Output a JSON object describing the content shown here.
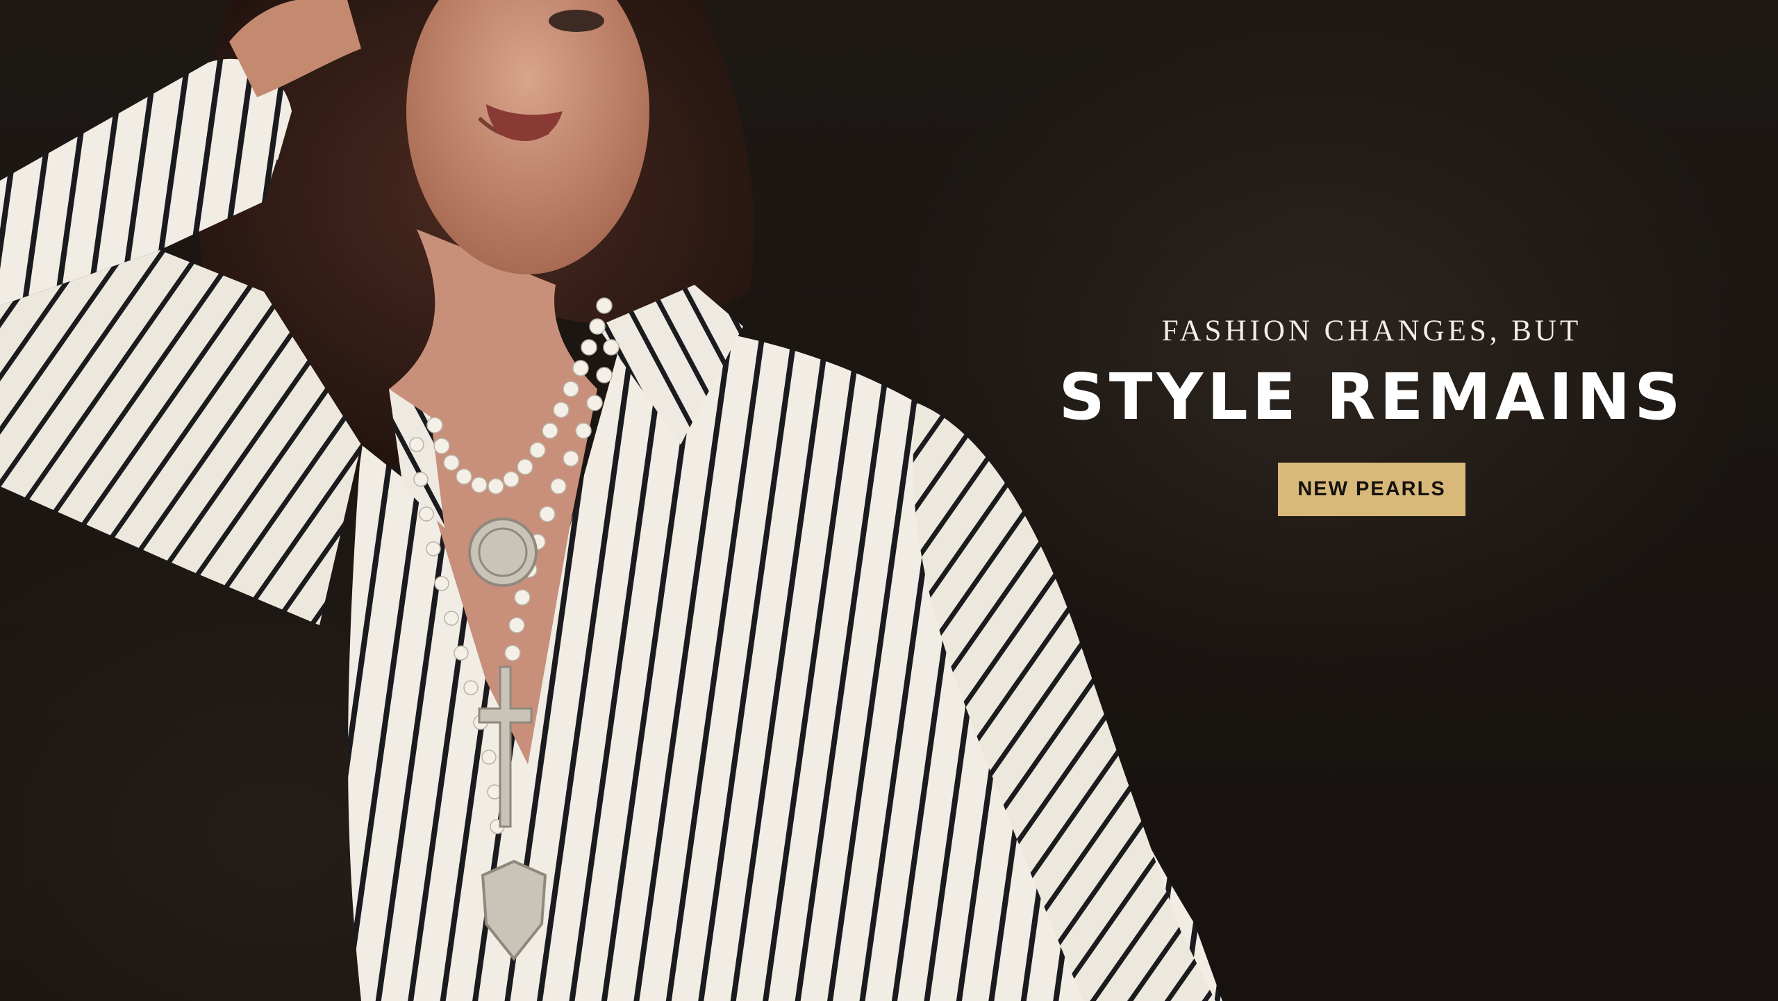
{
  "hero": {
    "eyebrow": "FASHION CHANGES, BUT",
    "headline": "STYLE REMAINS",
    "cta_label": "NEW PEARLS",
    "colors": {
      "background": "#1a1512",
      "cta_background": "#d9b97a",
      "cta_text": "#15110e",
      "headline": "#ffffff"
    }
  }
}
